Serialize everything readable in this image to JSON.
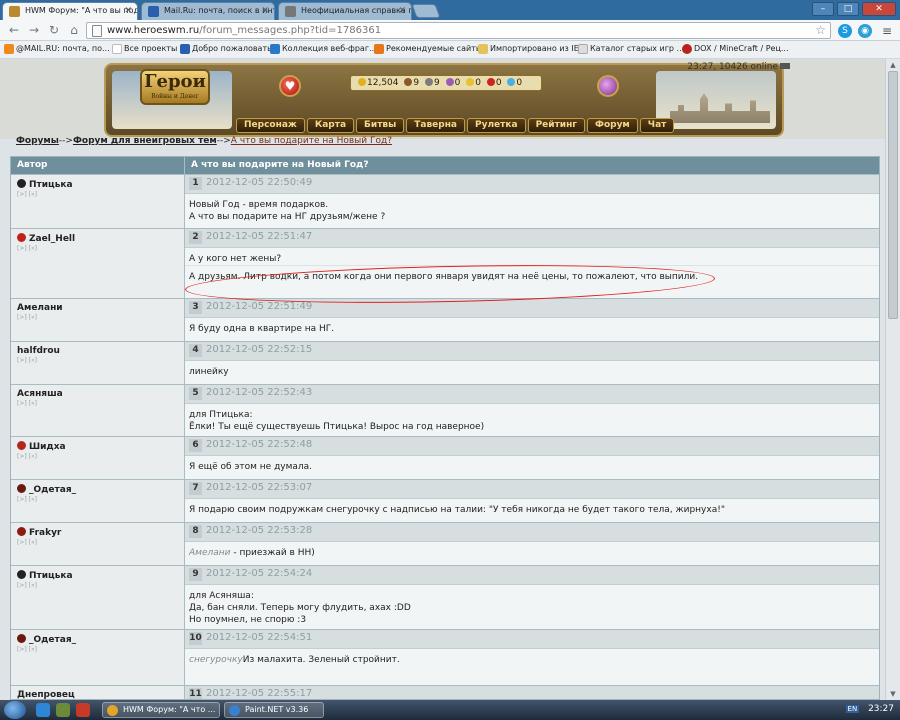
{
  "browser": {
    "tabs": [
      {
        "title": "HWM Форум: \"А что вы под",
        "favicon_color": "#b98a2e",
        "active": true
      },
      {
        "title": "Mail.Ru: почта, поиск в инт",
        "favicon_color": "#2a5fae",
        "active": false
      },
      {
        "title": "Неофициальная справка п",
        "favicon_color": "#777777",
        "active": false
      }
    ],
    "url_host": "www.heroeswm.ru",
    "url_path": "/forum_messages.php?tid=1786361",
    "bookmarks": [
      {
        "label": "@MAIL.RU: почта, по...",
        "icon_color": "#f18a1a"
      },
      {
        "label": "Все проекты",
        "icon_color": "#ffffff"
      },
      {
        "label": "Добро пожаловать",
        "icon_color": "#2a5fae"
      },
      {
        "label": "Коллекция веб-фраг...",
        "icon_color": "#2a79c8"
      },
      {
        "label": "Рекомендуемые сайты",
        "icon_color": "#e5761b"
      },
      {
        "label": "Импортировано из IE",
        "icon_color": "#e6c35a"
      },
      {
        "label": "Каталог старых игр ...",
        "icon_color": "#dddddd"
      },
      {
        "label": "DOX / MineCraft / Рец...",
        "icon_color": "#b8241c"
      }
    ]
  },
  "game": {
    "logo_text": "Герои",
    "logo_sub": "Войны и Денег",
    "resources": [
      "12,504",
      "9",
      "9",
      "0",
      "0",
      "0",
      "0"
    ],
    "clock": "23:27, 10426 online",
    "menu": [
      "Персонаж",
      "Карта",
      "Битвы",
      "Таверна",
      "Рулетка",
      "Рейтинг",
      "Форум",
      "Чат"
    ]
  },
  "breadcrumb": {
    "root": "Форумы",
    "arrow": "-->",
    "section": "Форум для внеигровых тем",
    "current": "А что вы подарите на Новый Год?"
  },
  "table": {
    "col_author": "Автор",
    "col_topic": "А что вы подарите на Новый Год?",
    "author_links": "[>] [«]"
  },
  "posts": [
    {
      "author": "Птицька",
      "icon_color": "#222222",
      "num": "1",
      "date": "2012-12-05 22:50:49",
      "body": "Новый Год - время подарков.\nА что вы подарите на НГ друзьям/жене ?"
    },
    {
      "author": "Zael_Hell",
      "icon_color": "#c0221a",
      "num": "2",
      "date": "2012-12-05 22:51:47",
      "body": "А у кого нет жены?",
      "body2": "А друзьям. Литр водки, а потом когда они первого января увидят на неё цены, то пожалеют, что выпили."
    },
    {
      "author": "Амелани",
      "icon_color": "",
      "num": "3",
      "date": "2012-12-05 22:51:49",
      "body": "Я буду одна в квартире на НГ."
    },
    {
      "author": "halfdrou",
      "icon_color": "",
      "num": "4",
      "date": "2012-12-05 22:52:15",
      "body": "линейку"
    },
    {
      "author": "Асяняша",
      "icon_color": "",
      "num": "5",
      "date": "2012-12-05 22:52:43",
      "body": "для Птицька:\nЁлки! Ты ещё существуешь Птицька! Вырос на год наверное)"
    },
    {
      "author": "Шидха",
      "icon_color": "#b3281e",
      "num": "6",
      "date": "2012-12-05 22:52:48",
      "body": "Я ещё об этом не думала."
    },
    {
      "author": "_Одетая_",
      "icon_color": "#6b1a12",
      "num": "7",
      "date": "2012-12-05 22:53:07",
      "body": "Я подарю своим подружкам снегурочку с надписью на талии: \"У тебя никогда не будет такого тела, жирнуха!\""
    },
    {
      "author": "Frakyr",
      "icon_color": "#8e1a14",
      "num": "8",
      "date": "2012-12-05 22:53:28",
      "quote": "Амелани",
      "body": " - приезжай в НН)"
    },
    {
      "author": "Птицька",
      "icon_color": "#222222",
      "num": "9",
      "date": "2012-12-05 22:54:24",
      "body": "для Асяняша:\nДа, бан сняли. Теперь могу флудить, ахах :DD\nНо поумнел, не спорю :3"
    },
    {
      "author": "_Одетая_",
      "icon_color": "#6b1a12",
      "num": "10",
      "date": "2012-12-05 22:54:51",
      "quote": "снегурочку",
      "body": "Из малахита. Зеленый стройнит."
    },
    {
      "author": "Днепровец",
      "icon_color": "",
      "num": "11",
      "date": "2012-12-05 22:55:17",
      "body": ""
    }
  ],
  "taskbar": {
    "tasks": [
      {
        "label": "HWM Форум: \"А что ...",
        "icon_color": "#e0a52a"
      },
      {
        "label": "Paint.NET v3.36",
        "icon_color": "#3b7fd1"
      }
    ],
    "lang": "EN",
    "time": "23:27"
  },
  "colors": {
    "highlight_ellipse": "#e02020",
    "table_header": "#6f8f9c"
  }
}
